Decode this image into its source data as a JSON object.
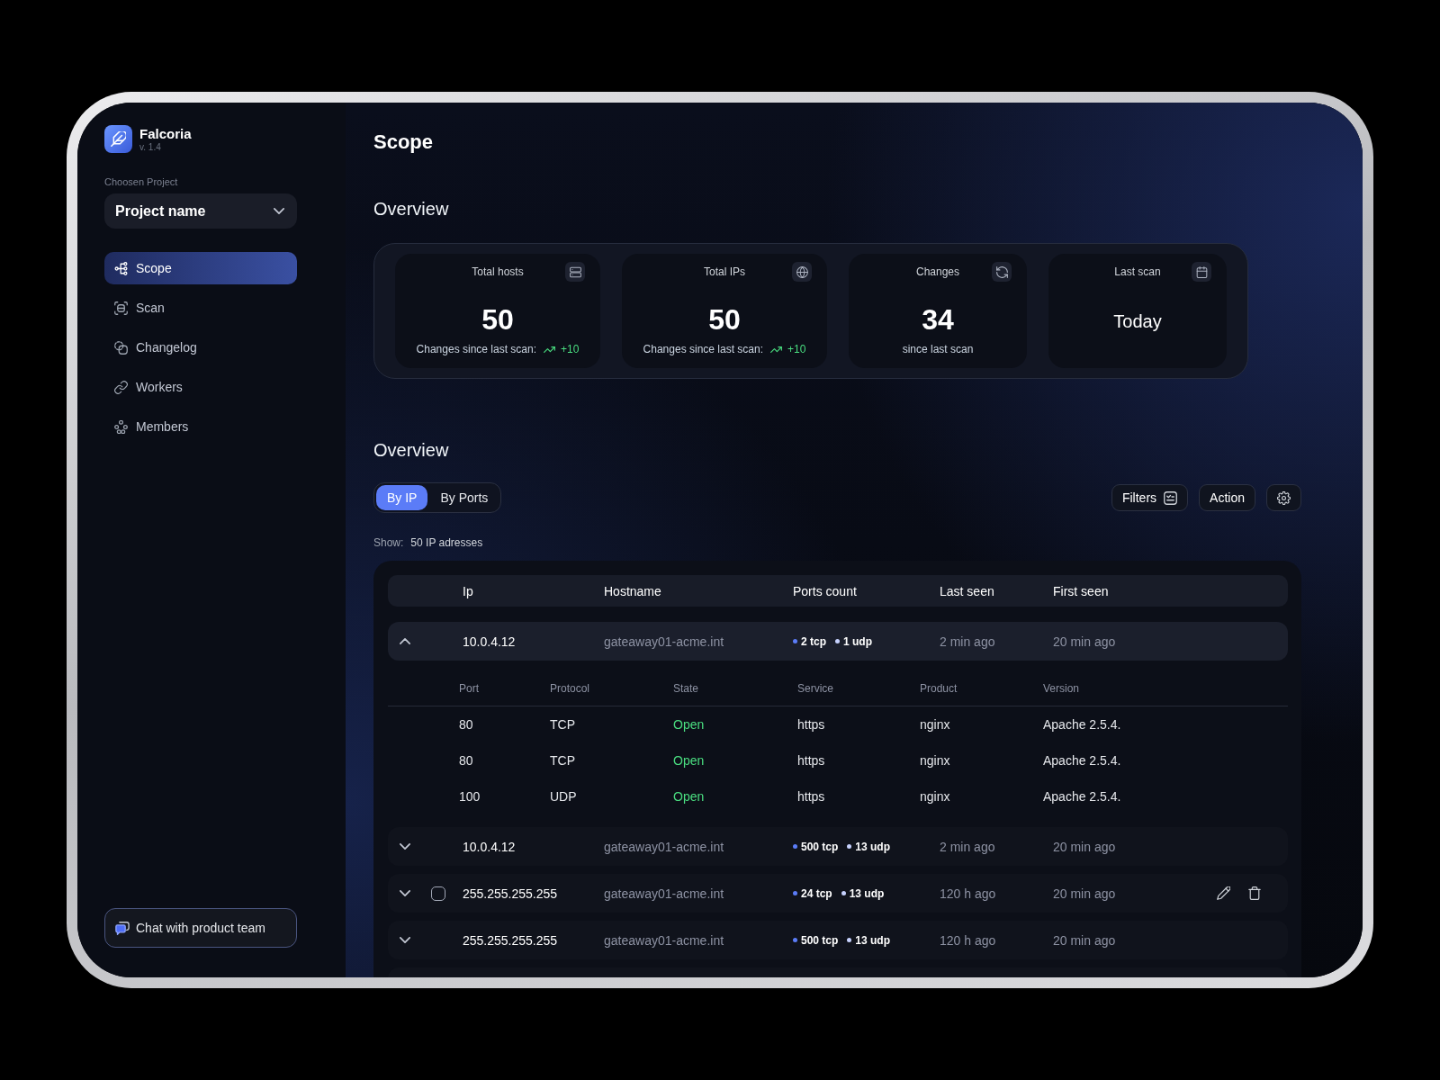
{
  "sidebar": {
    "app_name": "Falcoria",
    "version": "v. 1.4",
    "project_label": "Choosen Project",
    "project_value": "Project name",
    "nav": [
      {
        "label": "Scope",
        "selected": true
      },
      {
        "label": "Scan",
        "selected": false
      },
      {
        "label": "Changelog",
        "selected": false
      },
      {
        "label": "Workers",
        "selected": false
      },
      {
        "label": "Members",
        "selected": false
      }
    ],
    "chat_button": "Chat with product team"
  },
  "page_title": "Scope",
  "overview": {
    "title": "Overview",
    "stats": [
      {
        "kind": "trend",
        "title": "Total hosts",
        "value": "50",
        "caption": "Changes since last scan:",
        "rising": true,
        "delta": "+10"
      },
      {
        "kind": "trend",
        "title": "Total IPs",
        "value": "50",
        "caption": "Changes since last scan:",
        "rising": true,
        "delta": "+10"
      },
      {
        "kind": "count",
        "title": "Changes",
        "value": "34",
        "caption": "since last scan"
      },
      {
        "kind": "text",
        "title": "Last scan",
        "value": "Today"
      }
    ]
  },
  "hosts": {
    "title": "Overview",
    "views": [
      {
        "label": "By IP",
        "selected": true
      },
      {
        "label": "By Ports",
        "selected": false
      }
    ],
    "toolbar": [
      {
        "kind": "filters",
        "label": "Filters"
      },
      {
        "kind": "action",
        "label": "Action"
      },
      {
        "kind": "settings"
      }
    ],
    "show_label": "Show:",
    "show_value": "50 IP adresses",
    "table": {
      "columns": [
        "Ip",
        "Hostname",
        "Ports count",
        "Last seen",
        "First seen"
      ],
      "rows": [
        {
          "ip": "10.0.4.12",
          "hostname": "gateaway01-acme.int",
          "ports": [
            {
              "label": "2 tcp",
              "color": "#5b7cf7"
            },
            {
              "label": "1 udp",
              "color": "#c7d2fe"
            }
          ],
          "last_seen": "2 min ago",
          "first_seen": "20 min ago",
          "expanded": true,
          "hovered": false,
          "details": {
            "columns": [
              "Port",
              "Protocol",
              "State",
              "Service",
              "Product",
              "Version"
            ],
            "rows": [
              {
                "port": "80",
                "protocol": "TCP",
                "state": "Open",
                "state_ok": true,
                "service": "https",
                "product": "nginx",
                "version": "Apache 2.5.4."
              },
              {
                "port": "80",
                "protocol": "TCP",
                "state": "Open",
                "state_ok": true,
                "service": "https",
                "product": "nginx",
                "version": "Apache 2.5.4."
              },
              {
                "port": "100",
                "protocol": "UDP",
                "state": "Open",
                "state_ok": true,
                "service": "https",
                "product": "nginx",
                "version": "Apache 2.5.4."
              }
            ]
          }
        },
        {
          "ip": "10.0.4.12",
          "hostname": "gateaway01-acme.int",
          "ports": [
            {
              "label": "500 tcp",
              "color": "#5b7cf7"
            },
            {
              "label": "13 udp",
              "color": "#c7d2fe"
            }
          ],
          "last_seen": "2 min ago",
          "first_seen": "20 min ago",
          "expanded": false,
          "hovered": false
        },
        {
          "ip": "255.255.255.255",
          "hostname": "gateaway01-acme.int",
          "ports": [
            {
              "label": "24 tcp",
              "color": "#5b7cf7"
            },
            {
              "label": "13 udp",
              "color": "#c7d2fe"
            }
          ],
          "last_seen": "120 h ago",
          "first_seen": "20 min ago",
          "expanded": false,
          "hovered": true,
          "checked": false
        },
        {
          "ip": "255.255.255.255",
          "hostname": "gateaway01-acme.int",
          "ports": [
            {
              "label": "500 tcp",
              "color": "#5b7cf7"
            },
            {
              "label": "13 udp",
              "color": "#c7d2fe"
            }
          ],
          "last_seen": "120 h ago",
          "first_seen": "20 min ago",
          "expanded": false,
          "hovered": false
        }
      ]
    }
  }
}
